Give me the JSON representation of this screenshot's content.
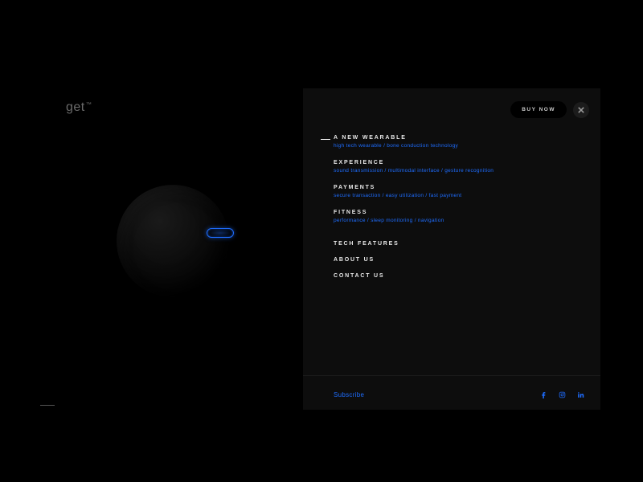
{
  "brand": {
    "name": "get",
    "trademark": "™"
  },
  "header": {
    "buy_label": "BUY NOW"
  },
  "menu": {
    "primary": [
      {
        "title": "A NEW WEARABLE",
        "subtitle": "high tech wearable / bone conduction technology",
        "active": true
      },
      {
        "title": "EXPERIENCE",
        "subtitle": "sound transmission / multimodal interface / gesture recognition",
        "active": false
      },
      {
        "title": "PAYMENTS",
        "subtitle": "secure transaction / easy utilization / fast payment",
        "active": false
      },
      {
        "title": "FITNESS",
        "subtitle": "performance / sleep monitoring / navigation",
        "active": false
      }
    ],
    "secondary": [
      {
        "label": "TECH FEATURES"
      },
      {
        "label": "ABOUT US"
      },
      {
        "label": "CONTACT US"
      }
    ]
  },
  "footer": {
    "subscribe": "Subscribe"
  },
  "icons": {
    "close": "close-icon",
    "facebook": "facebook-icon",
    "instagram": "instagram-icon",
    "linkedin": "linkedin-icon"
  },
  "colors": {
    "accent": "#1e6dff",
    "panel": "#0d0d0d",
    "bg": "#000000"
  }
}
